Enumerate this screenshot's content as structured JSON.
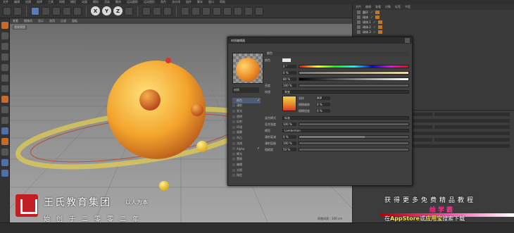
{
  "menubar": {
    "items": [
      "文件",
      "编辑",
      "创建",
      "选择",
      "工具",
      "网格",
      "捕捉",
      "动画",
      "模拟",
      "渲染",
      "雕刻",
      "运动跟踪",
      "运动图形",
      "角色",
      "流水线",
      "插件",
      "脚本",
      "窗口",
      "帮助"
    ]
  },
  "toolbar": {
    "axes": [
      "X",
      "Y",
      "Z"
    ]
  },
  "viewport": {
    "menu": [
      "查看",
      "摄像机",
      "显示",
      "选项",
      "过滤",
      "面板"
    ],
    "label": "透视视图",
    "grid_readout": "网格间距 : 100 cm"
  },
  "dialog": {
    "title": "材质编辑器",
    "material_name": "材质",
    "channels": [
      {
        "label": "颜色",
        "checked": true,
        "selected": true
      },
      {
        "label": "漫射",
        "checked": false
      },
      {
        "label": "发光",
        "checked": false
      },
      {
        "label": "透明",
        "checked": false
      },
      {
        "label": "反射",
        "checked": false
      },
      {
        "label": "环境",
        "checked": false
      },
      {
        "label": "烟雾",
        "checked": false
      },
      {
        "label": "凹凸",
        "checked": false
      },
      {
        "label": "法线",
        "checked": false
      },
      {
        "label": "Alpha",
        "checked": true
      },
      {
        "label": "辉光",
        "checked": false
      },
      {
        "label": "置换",
        "checked": false
      },
      {
        "label": "编辑",
        "checked": false
      },
      {
        "label": "光照",
        "checked": false
      },
      {
        "label": "指定",
        "checked": false
      }
    ],
    "section_title": "颜色",
    "color_label": "颜色",
    "hue_value": "0 °",
    "sat_value": "0 %",
    "val_value": "80 %",
    "brightness_label": "亮度",
    "brightness_value": "100 %",
    "texture_label": "纹理",
    "texture_name": "渐变",
    "sampling_label": "采样",
    "sampling_value": "MIP",
    "blur_offset_label": "模糊偏移",
    "blur_offset_value": "0 %",
    "blur_scale_label": "模糊程度",
    "blur_scale_value": "0 %",
    "mix_mode_label": "混合模式",
    "mix_mode_value": "标准",
    "mix_strength_label": "混合强度",
    "mix_strength_value": "100 %",
    "model_label": "模型",
    "model_value": "Lambertian",
    "diffuse_falloff_label": "漫射衰减",
    "diffuse_falloff_value": "0 %",
    "diffuse_level_label": "漫射层级",
    "diffuse_level_value": "100 %",
    "roughness_label": "粗糙度",
    "roughness_value": "50 %"
  },
  "objmgr": {
    "menu": [
      "文件",
      "编辑",
      "查看",
      "对象",
      "标签",
      "书签"
    ],
    "rows": [
      "圆环",
      "球体",
      "球体.1",
      "球体.2",
      "球体.3"
    ]
  },
  "brand": {
    "title": "王氏教育集团",
    "motto": "以人为本",
    "since": "始创于二零零二年"
  },
  "promo": {
    "line1": "获得更多免费精品教程",
    "logo": "绘学霸",
    "line2_prefix": "在",
    "line2_store": "AppStore",
    "line2_or": "或",
    "line2_app": "应用宝",
    "line2_suffix": "搜索下载"
  }
}
